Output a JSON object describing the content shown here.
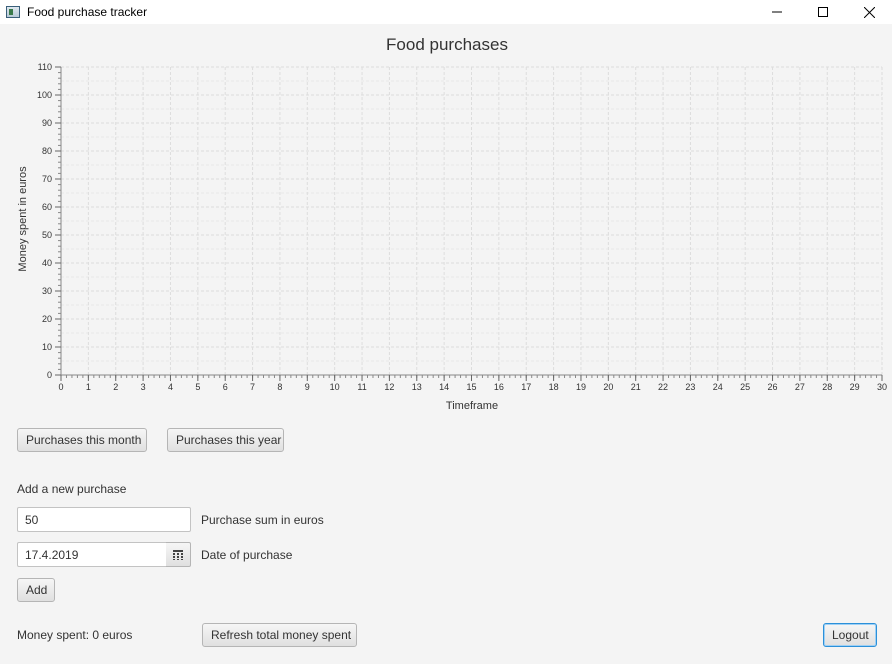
{
  "window": {
    "title": "Food purchase tracker",
    "controls": [
      "minimize-icon",
      "maximize-icon",
      "close-icon"
    ]
  },
  "chart_data": {
    "type": "line",
    "title": "Food purchases",
    "xlabel": "Timeframe",
    "ylabel": "Money spent in euros",
    "xlim": [
      0,
      30
    ],
    "ylim": [
      0,
      110
    ],
    "x_ticks": [
      "0",
      "1",
      "2",
      "3",
      "4",
      "5",
      "6",
      "7",
      "8",
      "9",
      "10",
      "11",
      "12",
      "13",
      "14",
      "15",
      "16",
      "17",
      "18",
      "19",
      "20",
      "21",
      "22",
      "23",
      "24",
      "25",
      "26",
      "27",
      "28",
      "29",
      "30"
    ],
    "y_ticks": [
      "0",
      "10",
      "20",
      "30",
      "40",
      "50",
      "60",
      "70",
      "80",
      "90",
      "100",
      "110"
    ],
    "grid": true,
    "series": []
  },
  "period_buttons": {
    "month": "Purchases this month",
    "year": "Purchases this year"
  },
  "add_form": {
    "heading": "Add a new purchase",
    "sum_value": "50",
    "sum_label": "Purchase sum in euros",
    "date_value": "17.4.2019",
    "date_label": "Date of purchase",
    "date_icon": "calendar-icon",
    "add_button": "Add"
  },
  "footer": {
    "money_spent": "Money spent: 0 euros",
    "refresh_button": "Refresh total money spent",
    "logout_button": "Logout"
  },
  "colors": {
    "background": "#f4f4f4",
    "grid": "#dddddd",
    "focus": "#2b90d9"
  }
}
